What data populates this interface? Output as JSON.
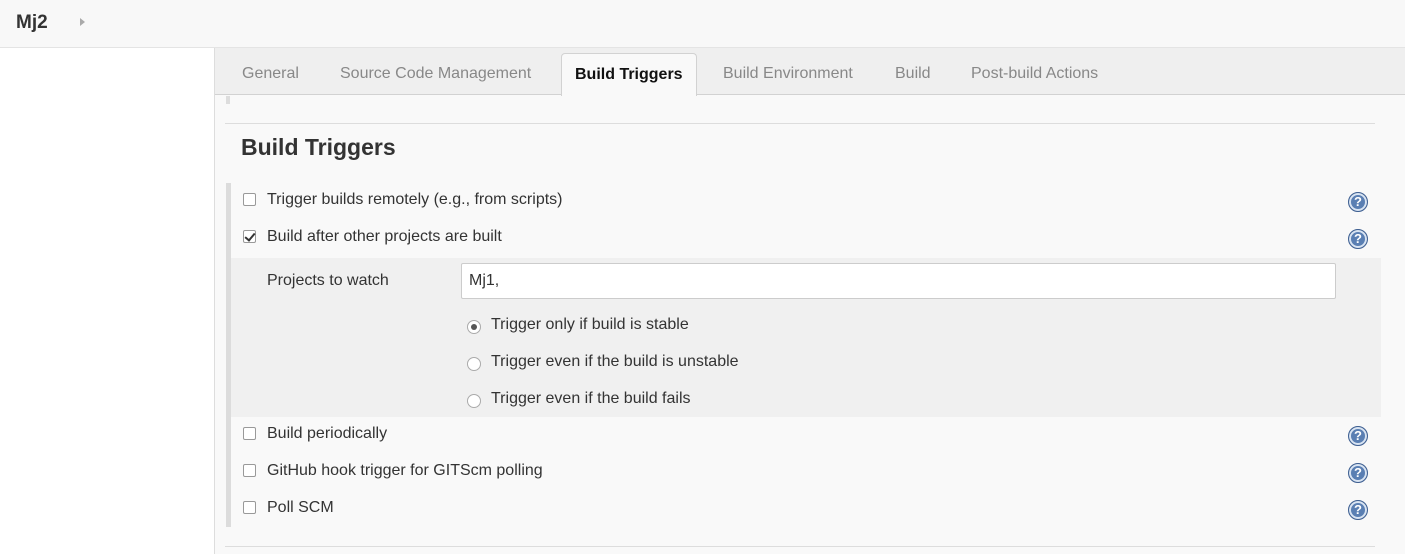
{
  "breadcrumb": {
    "job_name": "Mj2"
  },
  "tabs": [
    {
      "label": "General"
    },
    {
      "label": "Source Code Management"
    },
    {
      "label": "Build Triggers"
    },
    {
      "label": "Build Environment"
    },
    {
      "label": "Build"
    },
    {
      "label": "Post-build Actions"
    }
  ],
  "active_tab": "Build Triggers",
  "section": {
    "title": "Build Triggers"
  },
  "triggers": {
    "remote": {
      "label": "Trigger builds remotely (e.g., from scripts)",
      "checked": false
    },
    "after_other": {
      "label": "Build after other projects are built",
      "checked": true
    },
    "periodically": {
      "label": "Build periodically",
      "checked": false
    },
    "github_hook": {
      "label": "GitHub hook trigger for GITScm polling",
      "checked": false
    },
    "poll_scm": {
      "label": "Poll SCM",
      "checked": false
    }
  },
  "projects_to_watch": {
    "label": "Projects to watch",
    "value": "Mj1,",
    "options": [
      {
        "label": "Trigger only if build is stable",
        "selected": true
      },
      {
        "label": "Trigger even if the build is unstable",
        "selected": false
      },
      {
        "label": "Trigger even if the build fails",
        "selected": false
      }
    ]
  },
  "help_icon_glyph": "?",
  "colors": {
    "help_icon": "#5a7fb3",
    "tab_bar": "#efefef",
    "nested_block": "#f0f0f0"
  }
}
